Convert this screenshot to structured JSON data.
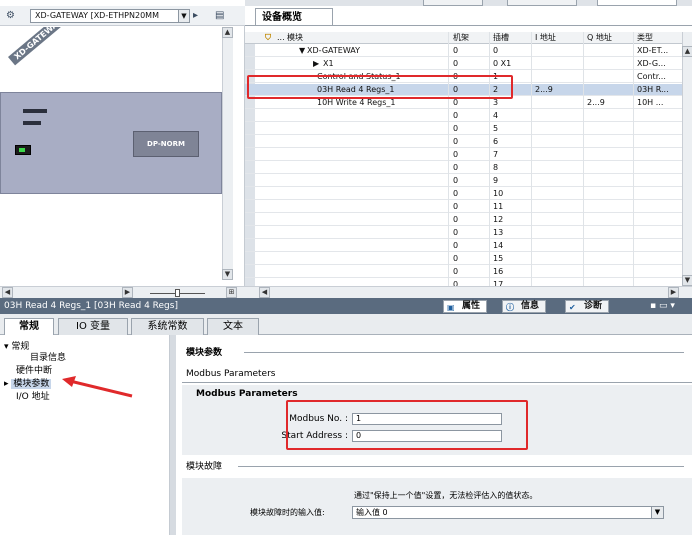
{
  "left_pane": {
    "device_select": "XD-GATEWAY [XD-ETHPN20MM",
    "device_tag": "XD-GATEWAY",
    "module_label": "DP-NORM"
  },
  "overview": {
    "tab": "设备概览",
    "columns": {
      "module": "模块",
      "rack": "机架",
      "slot": "插槽",
      "iaddr": "I 地址",
      "qaddr": "Q 地址",
      "type": "类型"
    },
    "rows": [
      {
        "module": "XD-GATEWAY",
        "rack": "0",
        "slot": "0",
        "iaddr": "",
        "qaddr": "",
        "type": "XD-ET..."
      },
      {
        "module": "X1",
        "rack": "0",
        "slot": "0 X1",
        "iaddr": "",
        "qaddr": "",
        "type": "XD-G..."
      },
      {
        "module": "Control and Status_1",
        "rack": "0",
        "slot": "1",
        "iaddr": "",
        "qaddr": "",
        "type": "Contr..."
      },
      {
        "module": "03H Read 4 Regs_1",
        "rack": "0",
        "slot": "2",
        "iaddr": "2...9",
        "qaddr": "",
        "type": "03H R..."
      },
      {
        "module": "10H Write 4 Regs_1",
        "rack": "0",
        "slot": "3",
        "iaddr": "",
        "qaddr": "2...9",
        "type": "10H ..."
      },
      {
        "module": "",
        "rack": "0",
        "slot": "4",
        "iaddr": "",
        "qaddr": "",
        "type": ""
      },
      {
        "module": "",
        "rack": "0",
        "slot": "5",
        "iaddr": "",
        "qaddr": "",
        "type": ""
      },
      {
        "module": "",
        "rack": "0",
        "slot": "6",
        "iaddr": "",
        "qaddr": "",
        "type": ""
      },
      {
        "module": "",
        "rack": "0",
        "slot": "7",
        "iaddr": "",
        "qaddr": "",
        "type": ""
      },
      {
        "module": "",
        "rack": "0",
        "slot": "8",
        "iaddr": "",
        "qaddr": "",
        "type": ""
      },
      {
        "module": "",
        "rack": "0",
        "slot": "9",
        "iaddr": "",
        "qaddr": "",
        "type": ""
      },
      {
        "module": "",
        "rack": "0",
        "slot": "10",
        "iaddr": "",
        "qaddr": "",
        "type": ""
      },
      {
        "module": "",
        "rack": "0",
        "slot": "11",
        "iaddr": "",
        "qaddr": "",
        "type": ""
      },
      {
        "module": "",
        "rack": "0",
        "slot": "12",
        "iaddr": "",
        "qaddr": "",
        "type": ""
      },
      {
        "module": "",
        "rack": "0",
        "slot": "13",
        "iaddr": "",
        "qaddr": "",
        "type": ""
      },
      {
        "module": "",
        "rack": "0",
        "slot": "14",
        "iaddr": "",
        "qaddr": "",
        "type": ""
      },
      {
        "module": "",
        "rack": "0",
        "slot": "15",
        "iaddr": "",
        "qaddr": "",
        "type": ""
      },
      {
        "module": "",
        "rack": "0",
        "slot": "16",
        "iaddr": "",
        "qaddr": "",
        "type": ""
      },
      {
        "module": "",
        "rack": "0",
        "slot": "17",
        "iaddr": "",
        "qaddr": "",
        "type": ""
      }
    ]
  },
  "properties": {
    "title": "03H Read 4 Regs_1 [03H Read 4 Regs]",
    "view_tabs": {
      "properties": "属性",
      "info": "信息",
      "diagnostics": "诊断"
    },
    "tabs": {
      "general": "常规",
      "io_vars": "IO 变量",
      "sys_const": "系统常数",
      "text": "文本"
    },
    "nav": {
      "general": "常规",
      "catalog": "目录信息",
      "hw_interrupt": "硬件中断",
      "module_params": "模块参数",
      "io_addr": "I/O 地址"
    },
    "section_title": "模块参数",
    "sub_title": "Modbus Parameters",
    "group_title": "Modbus Parameters",
    "modbus_no_label": "Modbus No. :",
    "modbus_no": "1",
    "start_address_label": "Start Address :",
    "start_address": "0",
    "fault_title": "模块故障",
    "fault_note": "通过\"保持上一个值\"设置，无法检评估入的值状态。",
    "fault_input_label": "模块故障时的输入值:",
    "fault_input_value": "输入值 0"
  },
  "colors": {
    "highlight": "#e0292b",
    "selection": "#c7d6ea",
    "title_bar": "#5a6b7f"
  }
}
